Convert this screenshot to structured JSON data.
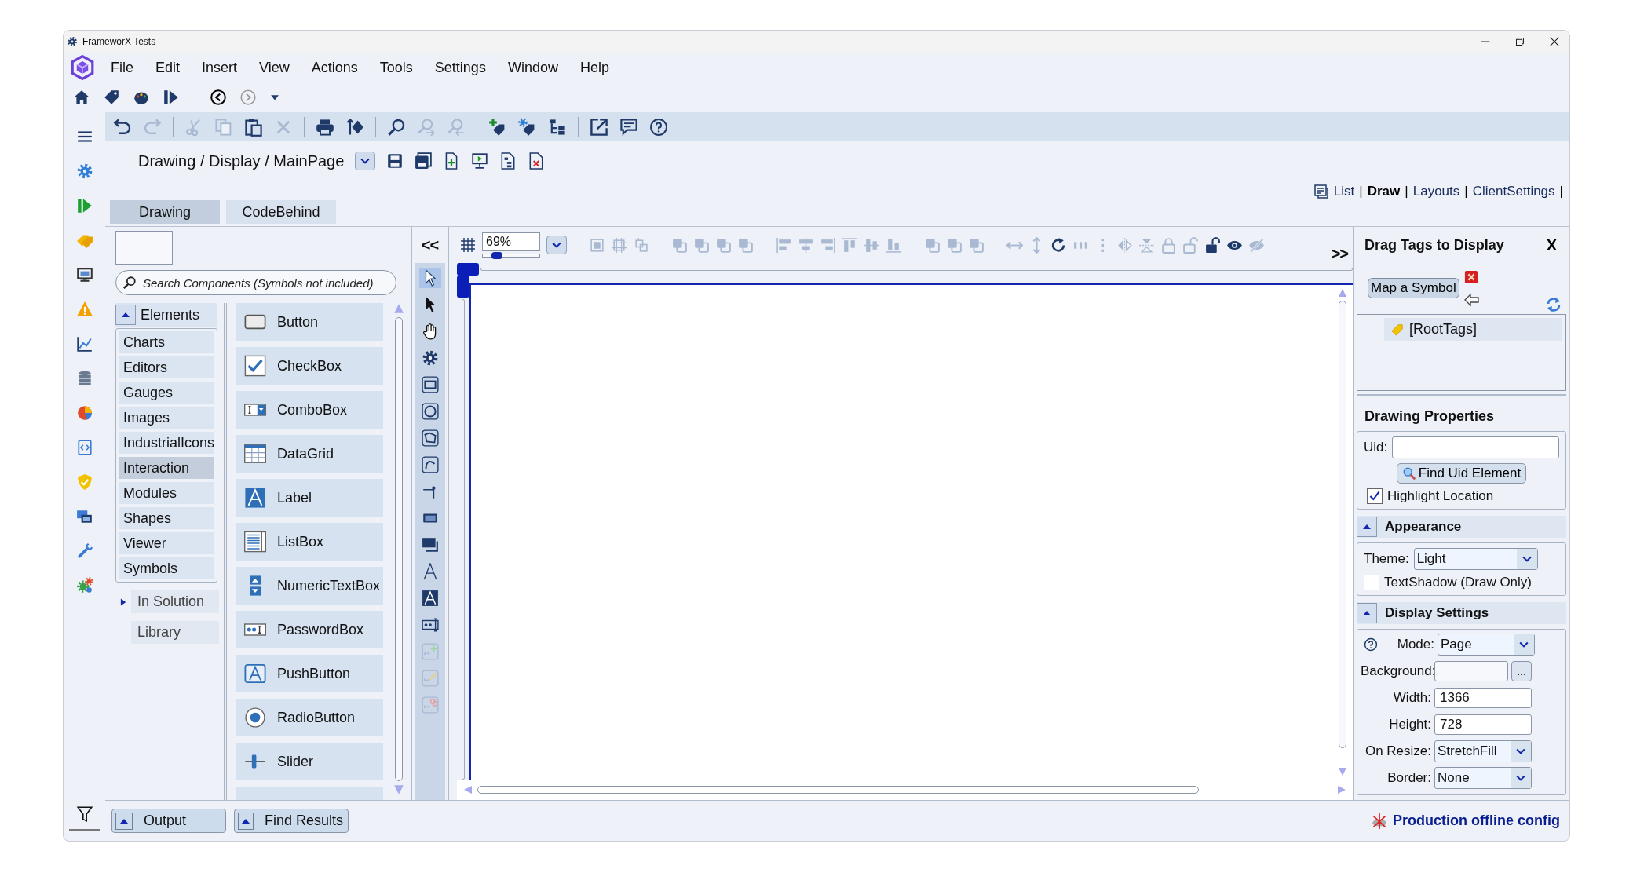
{
  "window": {
    "title": "FrameworX Tests"
  },
  "menu": [
    "File",
    "Edit",
    "Insert",
    "View",
    "Actions",
    "Tools",
    "Settings",
    "Window",
    "Help"
  ],
  "quick_toolbar": [
    {
      "kind": "home",
      "disabled": false
    },
    {
      "kind": "tag",
      "disabled": false
    },
    {
      "kind": "palette",
      "disabled": false
    },
    {
      "kind": "run",
      "disabled": false
    },
    {
      "kind": "back",
      "disabled": false
    },
    {
      "kind": "forward",
      "disabled": true
    },
    {
      "kind": "caret",
      "disabled": false
    }
  ],
  "sidebar": {
    "items": [
      {
        "kind": "menu"
      },
      {
        "kind": "gear"
      },
      {
        "kind": "run"
      },
      {
        "kind": "tags"
      },
      {
        "kind": "monitor"
      },
      {
        "kind": "warning"
      },
      {
        "kind": "chart"
      },
      {
        "kind": "database"
      },
      {
        "kind": "pie"
      },
      {
        "kind": "code-document"
      },
      {
        "kind": "shield"
      },
      {
        "kind": "screens"
      },
      {
        "kind": "wrench"
      },
      {
        "kind": "gears"
      }
    ],
    "footer": {
      "kind": "filter"
    }
  },
  "toolbar": [
    {
      "kind": "undo",
      "disabled": false
    },
    {
      "kind": "redo",
      "disabled": true
    },
    {
      "kind": "scissors",
      "disabled": true
    },
    {
      "kind": "copy",
      "disabled": true
    },
    {
      "kind": "clipboard",
      "disabled": false
    },
    {
      "kind": "delete",
      "disabled": true
    },
    {
      "kind": "printer",
      "disabled": false
    },
    {
      "kind": "compare",
      "disabled": false
    },
    {
      "kind": "search",
      "disabled": false
    },
    {
      "kind": "search-next",
      "disabled": true
    },
    {
      "kind": "search-previous",
      "disabled": true
    },
    {
      "kind": "tag-plus",
      "disabled": false
    },
    {
      "kind": "tag-gear",
      "disabled": false
    },
    {
      "kind": "tree",
      "disabled": false
    },
    {
      "kind": "external",
      "disabled": false
    },
    {
      "kind": "comment",
      "disabled": false
    },
    {
      "kind": "help",
      "disabled": false
    }
  ],
  "breadcrumb": {
    "path": "Drawing / Display / MainPage",
    "actions": [
      {
        "kind": "save"
      },
      {
        "kind": "save-all"
      },
      {
        "kind": "new-page"
      },
      {
        "kind": "run-display"
      },
      {
        "kind": "document-tree"
      },
      {
        "kind": "delete-document"
      }
    ]
  },
  "view_links": [
    {
      "label": "List",
      "suffix": "|",
      "selected": false
    },
    {
      "label": "Draw",
      "suffix": "|",
      "selected": true
    },
    {
      "label": "Layouts",
      "suffix": "|",
      "selected": false
    },
    {
      "label": "ClientSettings",
      "suffix": "|",
      "selected": false
    }
  ],
  "tabs": [
    {
      "label": "Drawing",
      "selected": true
    },
    {
      "label": "CodeBehind",
      "selected": false
    }
  ],
  "components": {
    "search": {
      "placeholder": "Search Components (Symbols not included)"
    },
    "groups": [
      {
        "label": "Elements",
        "expanded": true,
        "categories": [
          {
            "label": "Charts",
            "selected": false
          },
          {
            "label": "Editors",
            "selected": false
          },
          {
            "label": "Gauges",
            "selected": false
          },
          {
            "label": "Images",
            "selected": false
          },
          {
            "label": "IndustrialIcons",
            "selected": false
          },
          {
            "label": "Interaction",
            "selected": true
          },
          {
            "label": "Modules",
            "selected": false
          },
          {
            "label": "Shapes",
            "selected": false
          },
          {
            "label": "Viewer",
            "selected": false
          },
          {
            "label": "Symbols",
            "selected": false
          }
        ]
      },
      {
        "label": "In Solution",
        "expanded": false
      },
      {
        "label": "Library"
      }
    ],
    "items": [
      {
        "kind": "button",
        "label": "Button"
      },
      {
        "kind": "checkbox",
        "label": "CheckBox"
      },
      {
        "kind": "combobox",
        "label": "ComboBox"
      },
      {
        "kind": "datagrid",
        "label": "DataGrid"
      },
      {
        "kind": "label",
        "label": "Label"
      },
      {
        "kind": "listbox",
        "label": "ListBox"
      },
      {
        "kind": "numeric",
        "label": "NumericTextBox"
      },
      {
        "kind": "password",
        "label": "PasswordBox"
      },
      {
        "kind": "pushbutton",
        "label": "PushButton"
      },
      {
        "kind": "radio",
        "label": "RadioButton"
      },
      {
        "kind": "slider",
        "label": "Slider"
      },
      {
        "kind": "partial"
      }
    ]
  },
  "design_toolbar": {
    "collapse": "<<",
    "expand": ">>",
    "zoom": {
      "value": "69%",
      "level": 0.25
    },
    "tools": [
      {
        "kind": "frame",
        "disabled": true
      },
      {
        "kind": "group",
        "disabled": true
      },
      {
        "kind": "ungroup",
        "disabled": true
      },
      {
        "kind": "layers",
        "disabled": true
      },
      {
        "kind": "layers",
        "disabled": true
      },
      {
        "kind": "layers",
        "disabled": true
      },
      {
        "kind": "layers",
        "disabled": true
      },
      {
        "kind": "align-left",
        "disabled": true
      },
      {
        "kind": "align-center",
        "disabled": true
      },
      {
        "kind": "align-right",
        "disabled": true
      },
      {
        "kind": "align-top",
        "disabled": true
      },
      {
        "kind": "align-middle",
        "disabled": true
      },
      {
        "kind": "align-bottom",
        "disabled": true
      },
      {
        "kind": "layers",
        "disabled": true
      },
      {
        "kind": "layers",
        "disabled": true
      },
      {
        "kind": "layers",
        "disabled": true
      },
      {
        "kind": "arrows-horizontal",
        "disabled": true
      },
      {
        "kind": "arrows-vertical",
        "disabled": true
      },
      {
        "kind": "rotate",
        "disabled": false
      },
      {
        "kind": "bars",
        "disabled": true
      },
      {
        "kind": "dots",
        "disabled": true
      },
      {
        "kind": "flip-horizontal",
        "disabled": true
      },
      {
        "kind": "flip-vertical",
        "disabled": true
      },
      {
        "kind": "lock",
        "disabled": true
      },
      {
        "kind": "unlock",
        "disabled": true
      },
      {
        "kind": "padlock",
        "disabled": false
      },
      {
        "kind": "eye",
        "disabled": false
      },
      {
        "kind": "eye-off",
        "disabled": true
      }
    ]
  },
  "toolbox": [
    {
      "kind": "pointer",
      "selected": true,
      "disabled": false
    },
    {
      "kind": "arrow",
      "selected": false,
      "disabled": false
    },
    {
      "kind": "hand",
      "selected": false,
      "disabled": false
    },
    {
      "kind": "gear",
      "selected": false,
      "disabled": false
    },
    {
      "kind": "rectangle",
      "selected": false,
      "disabled": false
    },
    {
      "kind": "ellipse",
      "selected": false,
      "disabled": false
    },
    {
      "kind": "polygon",
      "selected": false,
      "disabled": false
    },
    {
      "kind": "curve",
      "selected": false,
      "disabled": false
    },
    {
      "kind": "connector",
      "selected": false,
      "disabled": false
    },
    {
      "kind": "panel",
      "selected": false,
      "disabled": false
    },
    {
      "kind": "panel-stack",
      "selected": false,
      "disabled": false
    },
    {
      "kind": "text-outline",
      "selected": false,
      "disabled": false
    },
    {
      "kind": "text-filled",
      "selected": false,
      "disabled": false
    },
    {
      "kind": "textbox",
      "selected": false,
      "disabled": false
    },
    {
      "kind": "symbol-add",
      "selected": false,
      "disabled": true
    },
    {
      "kind": "symbol-edit",
      "selected": false,
      "disabled": true
    },
    {
      "kind": "symbol-link",
      "selected": false,
      "disabled": true
    }
  ],
  "tags_panel": {
    "title": "Drag Tags to Display",
    "close": "X",
    "map_button": "Map a Symbol",
    "tree": [
      {
        "label": "[RootTags]",
        "selected": true
      }
    ]
  },
  "properties": {
    "title": "Drawing Properties",
    "uid_label": "Uid:",
    "find_button": "Find Uid Element",
    "highlight": {
      "label": "Highlight Location",
      "checked": true
    }
  },
  "appearance": {
    "title": "Appearance",
    "expanded": true,
    "theme": {
      "label": "Theme:",
      "value": "Light"
    },
    "text_shadow": {
      "label": "TextShadow (Draw Only)",
      "checked": false
    }
  },
  "display_settings": {
    "title": "Display Settings",
    "expanded": true,
    "fields": [
      {
        "kind": "dropdown",
        "label": "Mode:",
        "value": "Page"
      },
      {
        "kind": "color",
        "label": "Background:",
        "button": "..."
      },
      {
        "kind": "text",
        "label": "Width:",
        "value": "1366"
      },
      {
        "kind": "text",
        "label": "Height:",
        "value": "728"
      },
      {
        "kind": "dropdown",
        "label": "On Resize:",
        "value": "StretchFill"
      },
      {
        "kind": "dropdown",
        "label": "Border:",
        "value": "None"
      }
    ]
  },
  "bottom_panels": [
    {
      "label": "Output",
      "expanded": false
    },
    {
      "label": "Find Results",
      "expanded": false
    }
  ],
  "status_bar": {
    "config": "Production offline config"
  }
}
